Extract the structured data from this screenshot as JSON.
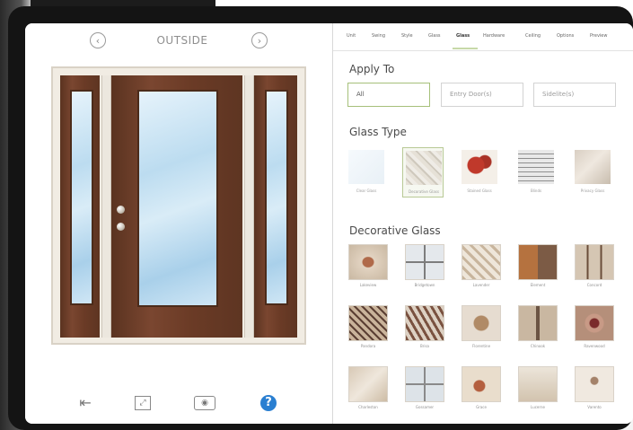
{
  "left_panel": {
    "view_label": "OUTSIDE",
    "prev_icon": "chevron-left-icon",
    "next_icon": "chevron-right-icon",
    "toolbar": [
      {
        "name": "exit-button",
        "icon": "exit-icon",
        "glyph": "⇤"
      },
      {
        "name": "fullscreen-button",
        "icon": "fullscreen-icon",
        "glyph": "⛶"
      },
      {
        "name": "camera-button",
        "icon": "camera-icon",
        "glyph": "◉"
      },
      {
        "name": "help-button",
        "icon": "help-icon",
        "glyph": "?"
      }
    ]
  },
  "tabs": [
    "Unit",
    "Swing",
    "Style",
    "Glass",
    "Glass",
    "Hardware",
    "Ceiling",
    "Options",
    "Preview"
  ],
  "active_tab_index": 4,
  "apply_to": {
    "heading": "Apply To",
    "options": [
      "All",
      "Entry Door(s)",
      "Sidelite(s)"
    ],
    "selected_index": 0
  },
  "glass_type": {
    "heading": "Glass Type",
    "items": [
      {
        "label": "Clear Glass"
      },
      {
        "label": "Decorative Glass"
      },
      {
        "label": "Stained Glass"
      },
      {
        "label": "Blinds"
      },
      {
        "label": "Privacy Glass"
      }
    ],
    "selected_index": 1
  },
  "decorative_glass": {
    "heading": "Decorative Glass",
    "items": [
      {
        "label": "Lakeview"
      },
      {
        "label": "Bridgetown"
      },
      {
        "label": "Lavender"
      },
      {
        "label": "Element"
      },
      {
        "label": "Concord"
      },
      {
        "label": "Pandora"
      },
      {
        "label": "Brisa"
      },
      {
        "label": "Florentine"
      },
      {
        "label": "Chinook"
      },
      {
        "label": "Ravenwood"
      },
      {
        "label": "Charleston"
      },
      {
        "label": "Gossamer"
      },
      {
        "label": "Grace"
      },
      {
        "label": "Lucerne"
      },
      {
        "label": "Varento"
      }
    ]
  },
  "colors": {
    "door_wood": "#6b3b26",
    "glass_blue": "#bcdcf0",
    "help_blue": "#2a7fd1",
    "selected_border": "#a6c07a"
  }
}
